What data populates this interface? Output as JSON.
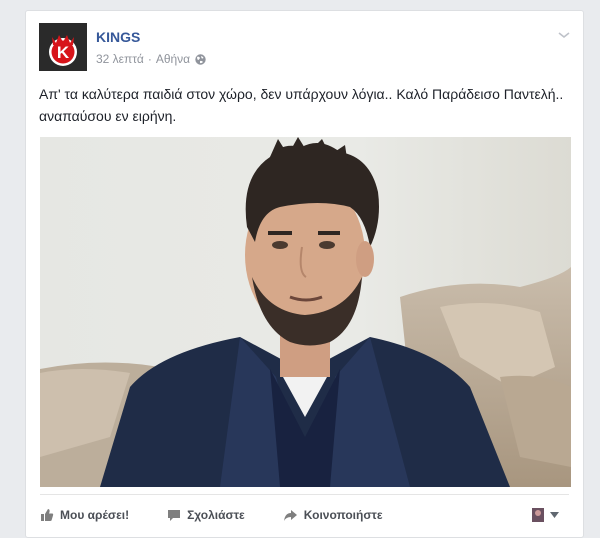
{
  "post": {
    "page_name": "KINGS",
    "time": "32 λεπτά",
    "separator": "·",
    "location": "Αθήνα",
    "text": "Απ' τα καλύτερα παιδιά στον χώρο, δεν υπάρχουν λόγια.. Καλό Παράδεισο Παντελή.. αναπαύσου εν ειρήνη."
  },
  "actions": {
    "like": "Μου αρέσει!",
    "comment": "Σχολιάστε",
    "share": "Κοινοποιήστε"
  },
  "icons": {
    "avatar": "kings-logo-icon",
    "privacy": "globe-icon",
    "menu": "chevron-down-icon",
    "like": "thumbs-up-icon",
    "comment": "comment-icon",
    "share": "share-arrow-icon",
    "audience": "dropdown-arrow-icon"
  },
  "colors": {
    "link": "#365899",
    "logo_red": "#d7141a",
    "jacket": "#1f2c47"
  }
}
